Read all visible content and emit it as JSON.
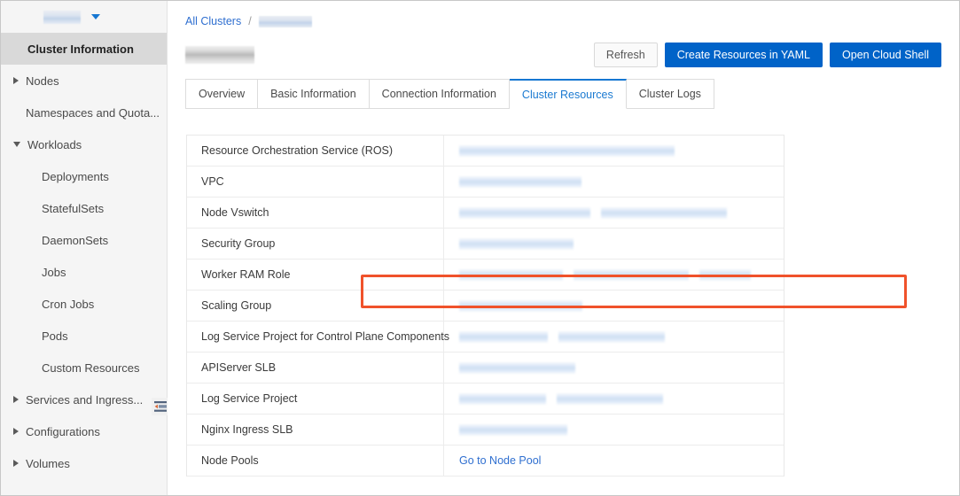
{
  "sidebar": {
    "header": {
      "back_icon": "chevron-left-icon",
      "cluster_name": "",
      "dropdown_icon": "caret-down-icon"
    },
    "collapse_icon": "collapse-panel-icon",
    "items": [
      {
        "label": "Cluster Information",
        "arrow": "none",
        "level": 0,
        "active": true
      },
      {
        "label": "Nodes",
        "arrow": "right",
        "level": 0,
        "active": false
      },
      {
        "label": "Namespaces and Quota...",
        "arrow": "none",
        "level": 0,
        "active": false
      },
      {
        "label": "Workloads",
        "arrow": "down",
        "level": 0,
        "active": false
      },
      {
        "label": "Deployments",
        "arrow": "none",
        "level": 1,
        "active": false
      },
      {
        "label": "StatefulSets",
        "arrow": "none",
        "level": 1,
        "active": false
      },
      {
        "label": "DaemonSets",
        "arrow": "none",
        "level": 1,
        "active": false
      },
      {
        "label": "Jobs",
        "arrow": "none",
        "level": 1,
        "active": false
      },
      {
        "label": "Cron Jobs",
        "arrow": "none",
        "level": 1,
        "active": false
      },
      {
        "label": "Pods",
        "arrow": "none",
        "level": 1,
        "active": false
      },
      {
        "label": "Custom Resources",
        "arrow": "none",
        "level": 1,
        "active": false
      },
      {
        "label": "Services and Ingress...",
        "arrow": "right",
        "level": 0,
        "active": false
      },
      {
        "label": "Configurations",
        "arrow": "right",
        "level": 0,
        "active": false
      },
      {
        "label": "Volumes",
        "arrow": "right",
        "level": 0,
        "active": false
      }
    ]
  },
  "breadcrumb": {
    "root_label": "All Clusters",
    "separator": "/",
    "current_label": ""
  },
  "page_title": "",
  "toolbar": {
    "refresh_label": "Refresh",
    "create_yaml_label": "Create Resources in YAML",
    "cloud_shell_label": "Open Cloud Shell"
  },
  "tabs": [
    {
      "label": "Overview",
      "active": false
    },
    {
      "label": "Basic Information",
      "active": false
    },
    {
      "label": "Connection Information",
      "active": false
    },
    {
      "label": "Cluster Resources",
      "active": true
    },
    {
      "label": "Cluster Logs",
      "active": false
    }
  ],
  "table": {
    "rows": [
      {
        "label": "Resource Orchestration Service (ROS)",
        "value_type": "redacted",
        "widths": [
          243
        ]
      },
      {
        "label": "VPC",
        "value_type": "redacted",
        "widths": [
          138
        ]
      },
      {
        "label": "Node Vswitch",
        "value_type": "redacted",
        "widths": [
          148,
          142
        ]
      },
      {
        "label": "Security Group",
        "value_type": "redacted",
        "widths": [
          129
        ]
      },
      {
        "label": "Worker RAM Role",
        "value_type": "redacted",
        "widths": [
          117,
          130,
          58
        ],
        "highlighted": true
      },
      {
        "label": "Scaling Group",
        "value_type": "redacted",
        "widths": [
          139
        ]
      },
      {
        "label": "Log Service Project for Control Plane Components",
        "value_type": "redacted",
        "widths": [
          100,
          120
        ]
      },
      {
        "label": "APIServer SLB",
        "value_type": "redacted",
        "widths": [
          131
        ]
      },
      {
        "label": "Log Service Project",
        "value_type": "redacted",
        "widths": [
          98,
          120
        ]
      },
      {
        "label": "Nginx Ingress SLB",
        "value_type": "redacted",
        "widths": [
          122
        ]
      },
      {
        "label": "Node Pools",
        "value_type": "link",
        "link_label": "Go to Node Pool"
      }
    ]
  },
  "colors": {
    "accent_blue": "#0063c8",
    "link_blue": "#2f6fd0",
    "tab_active": "#1677d2",
    "highlight_red": "#f0522b",
    "sidebar_bg": "#f5f5f5",
    "sidebar_active_bg": "#d9d9d9"
  }
}
